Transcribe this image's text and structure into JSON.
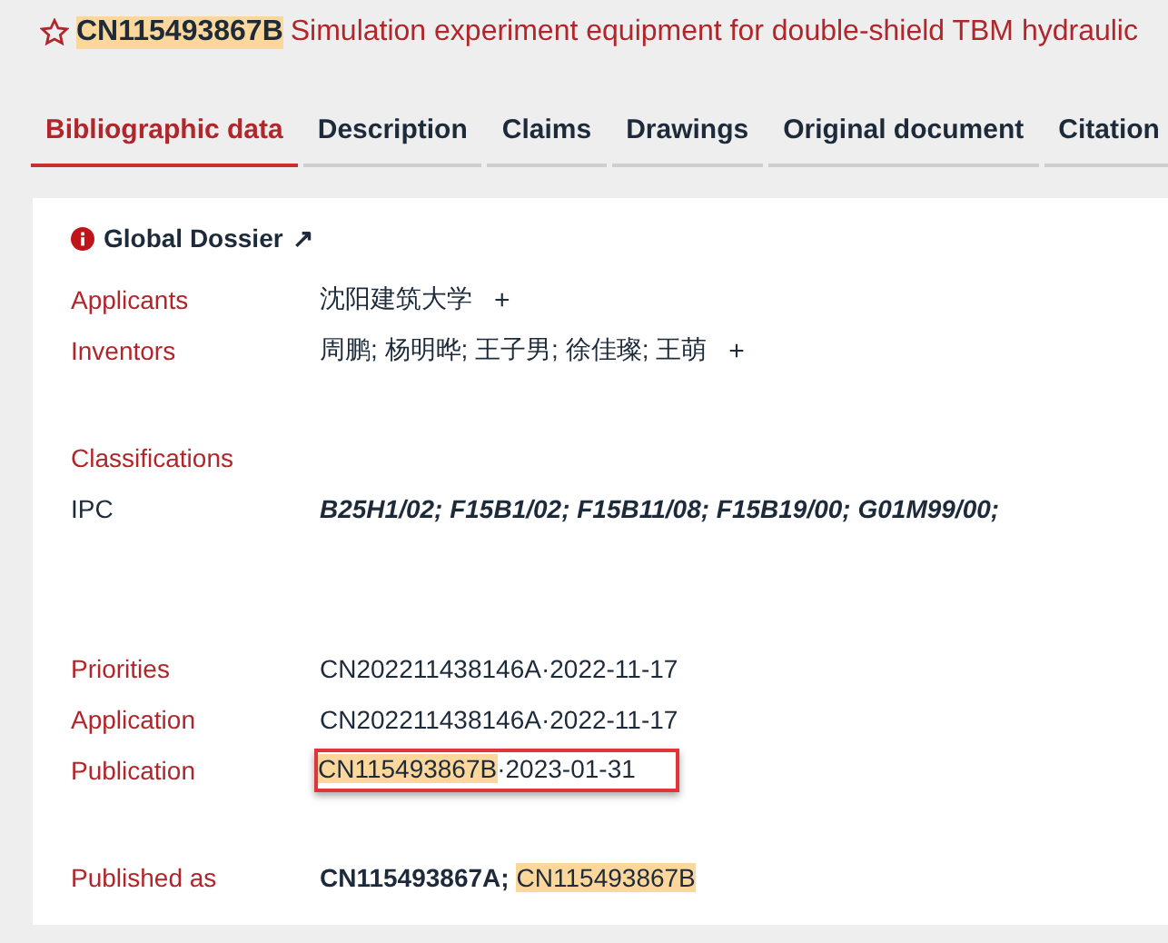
{
  "header": {
    "number": "CN115493867B",
    "number_highlighted": true,
    "title": "Simulation experiment equipment for double-shield TBM hydraulic"
  },
  "tabs": [
    {
      "label": "Bibliographic data",
      "selected": true
    },
    {
      "label": "Description",
      "selected": false
    },
    {
      "label": "Claims",
      "selected": false
    },
    {
      "label": "Drawings",
      "selected": false
    },
    {
      "label": "Original document",
      "selected": false
    },
    {
      "label": "Citation",
      "selected": false
    }
  ],
  "dossier": {
    "label": "Global Dossier",
    "arrow": "↗"
  },
  "groups": [
    {
      "rows": [
        {
          "label": "Applicants",
          "kind": "field",
          "segments": [
            {
              "text": "沈阳建筑大学",
              "kind": "text"
            }
          ],
          "more": "+"
        },
        {
          "label": "Inventors",
          "kind": "field",
          "segments": [
            {
              "text": "周鹏; 杨明晔; 王子男; 徐佳璨; 王萌",
              "kind": "text"
            }
          ],
          "more": "+"
        }
      ]
    },
    {
      "rows": [
        {
          "label": "Classifications",
          "kind": "heading"
        },
        {
          "label": "IPC",
          "kind": "subfield",
          "segments": [
            {
              "text": "B25H1/02; F15B1/02; F15B11/08; F15B19/00; G01M99/00;",
              "kind": "classes"
            }
          ]
        }
      ]
    },
    {
      "rows": [
        {
          "label": "Priorities",
          "kind": "field",
          "segments": [
            {
              "text": "CN202211438146A·2022-11-17",
              "kind": "text"
            }
          ]
        },
        {
          "label": "Application",
          "kind": "field",
          "segments": [
            {
              "text": "CN202211438146A·2022-11-17",
              "kind": "text"
            }
          ]
        },
        {
          "label": "Publication",
          "kind": "field",
          "segments": [
            {
              "text": "CN115493867B",
              "kind": "match"
            },
            {
              "text": "·2023-01-31",
              "kind": "text"
            }
          ],
          "boxed": true
        }
      ]
    },
    {
      "rows": [
        {
          "label": "Published as",
          "kind": "field",
          "segments": [
            {
              "text": "CN115493867A;",
              "kind": "member"
            },
            {
              "text": "CN115493867B",
              "kind": "match"
            }
          ]
        }
      ]
    }
  ]
}
